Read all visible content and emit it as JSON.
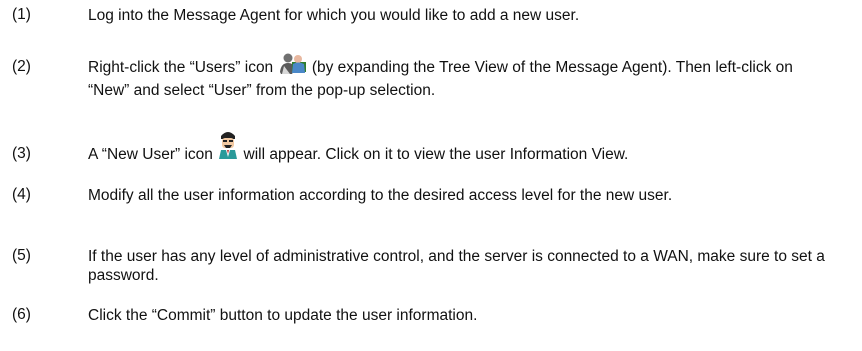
{
  "steps": [
    {
      "num": "(1)",
      "text": "Log into the Message Agent for which you would like to add a new user."
    },
    {
      "num": "(2)",
      "before": "Right-click the “Users” icon",
      "after": "(by expanding the Tree View of the Message Agent). Then left-click on “New” and select “User” from the pop-up selection.",
      "icon": "users-icon"
    },
    {
      "num": "(3)",
      "before": "A “New User” icon",
      "after": "will appear. Click on it to view the user Information View.",
      "icon": "new-user-icon"
    },
    {
      "num": "(4)",
      "text": "Modify all the user information according to the desired access level for the new user."
    },
    {
      "num": "(5)",
      "text": "If the user has any level of administrative control, and the server is connected to a WAN, make sure to set a password."
    },
    {
      "num": "(6)",
      "text": "Click the “Commit” button to update the user information."
    }
  ]
}
